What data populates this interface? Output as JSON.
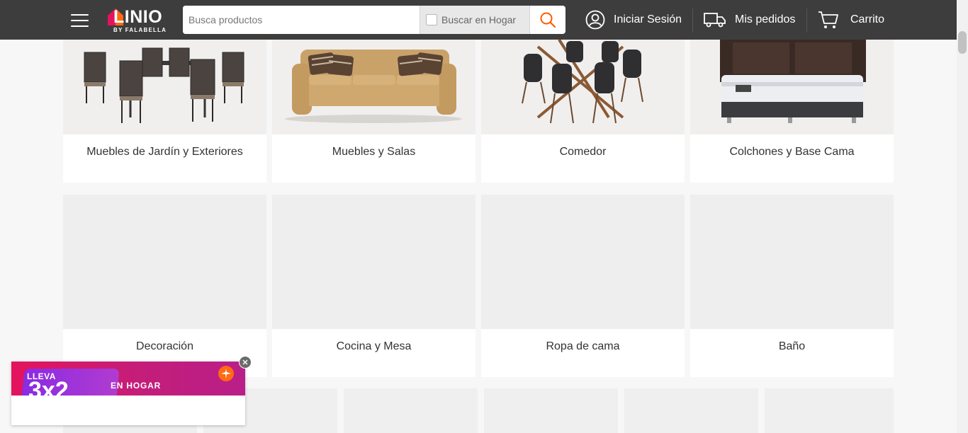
{
  "header": {
    "logo_text": "LINIO",
    "logo_sub": "BY FALABELLA",
    "search_placeholder": "Busca productos",
    "search_scope_label": "Buscar en Hogar",
    "login_label": "Iniciar Sesión",
    "orders_label": "Mis pedidos",
    "cart_label": "Carrito"
  },
  "categories_row1": [
    {
      "label": "Muebles de Jardín y Exteriores"
    },
    {
      "label": "Muebles y Salas"
    },
    {
      "label": "Comedor"
    },
    {
      "label": "Colchones y Base Cama"
    }
  ],
  "categories_row2": [
    {
      "label": "Decoración"
    },
    {
      "label": "Cocina y Mesa"
    },
    {
      "label": "Ropa de cama"
    },
    {
      "label": "Baño"
    }
  ],
  "promo": {
    "lleva": "LLEVA",
    "offer": "3x2",
    "text": "EN HOGAR"
  },
  "colors": {
    "header_bg": "#3d3d3d",
    "accent": "#ff5a00",
    "promo_pink": "#e4135e",
    "promo_purple": "#8a2be2"
  }
}
